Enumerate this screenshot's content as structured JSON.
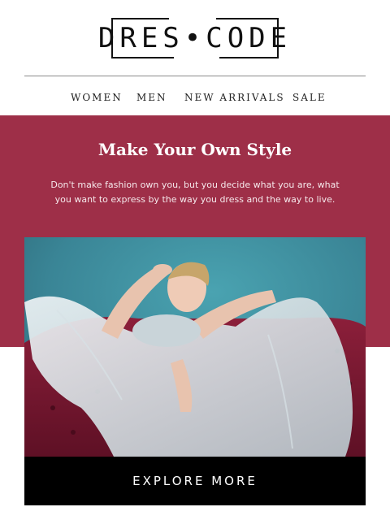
{
  "brand": {
    "logo_text": "DRES•CODE"
  },
  "nav": {
    "items": [
      {
        "label": "WOMEN"
      },
      {
        "label": "MEN"
      },
      {
        "label": "NEW ARRIVALS"
      },
      {
        "label": "SALE"
      }
    ]
  },
  "hero": {
    "title": "Make Your Own Style",
    "text": "Don't make fashion own you, but you decide what you are, what you want to express by the way you dress and the way to live."
  },
  "cta": {
    "label": "EXPLORE MORE"
  },
  "colors": {
    "accent": "#9e2f48",
    "background": "#ffffff",
    "cta": "#000000",
    "photo_backdrop": "#3f8e9e"
  }
}
